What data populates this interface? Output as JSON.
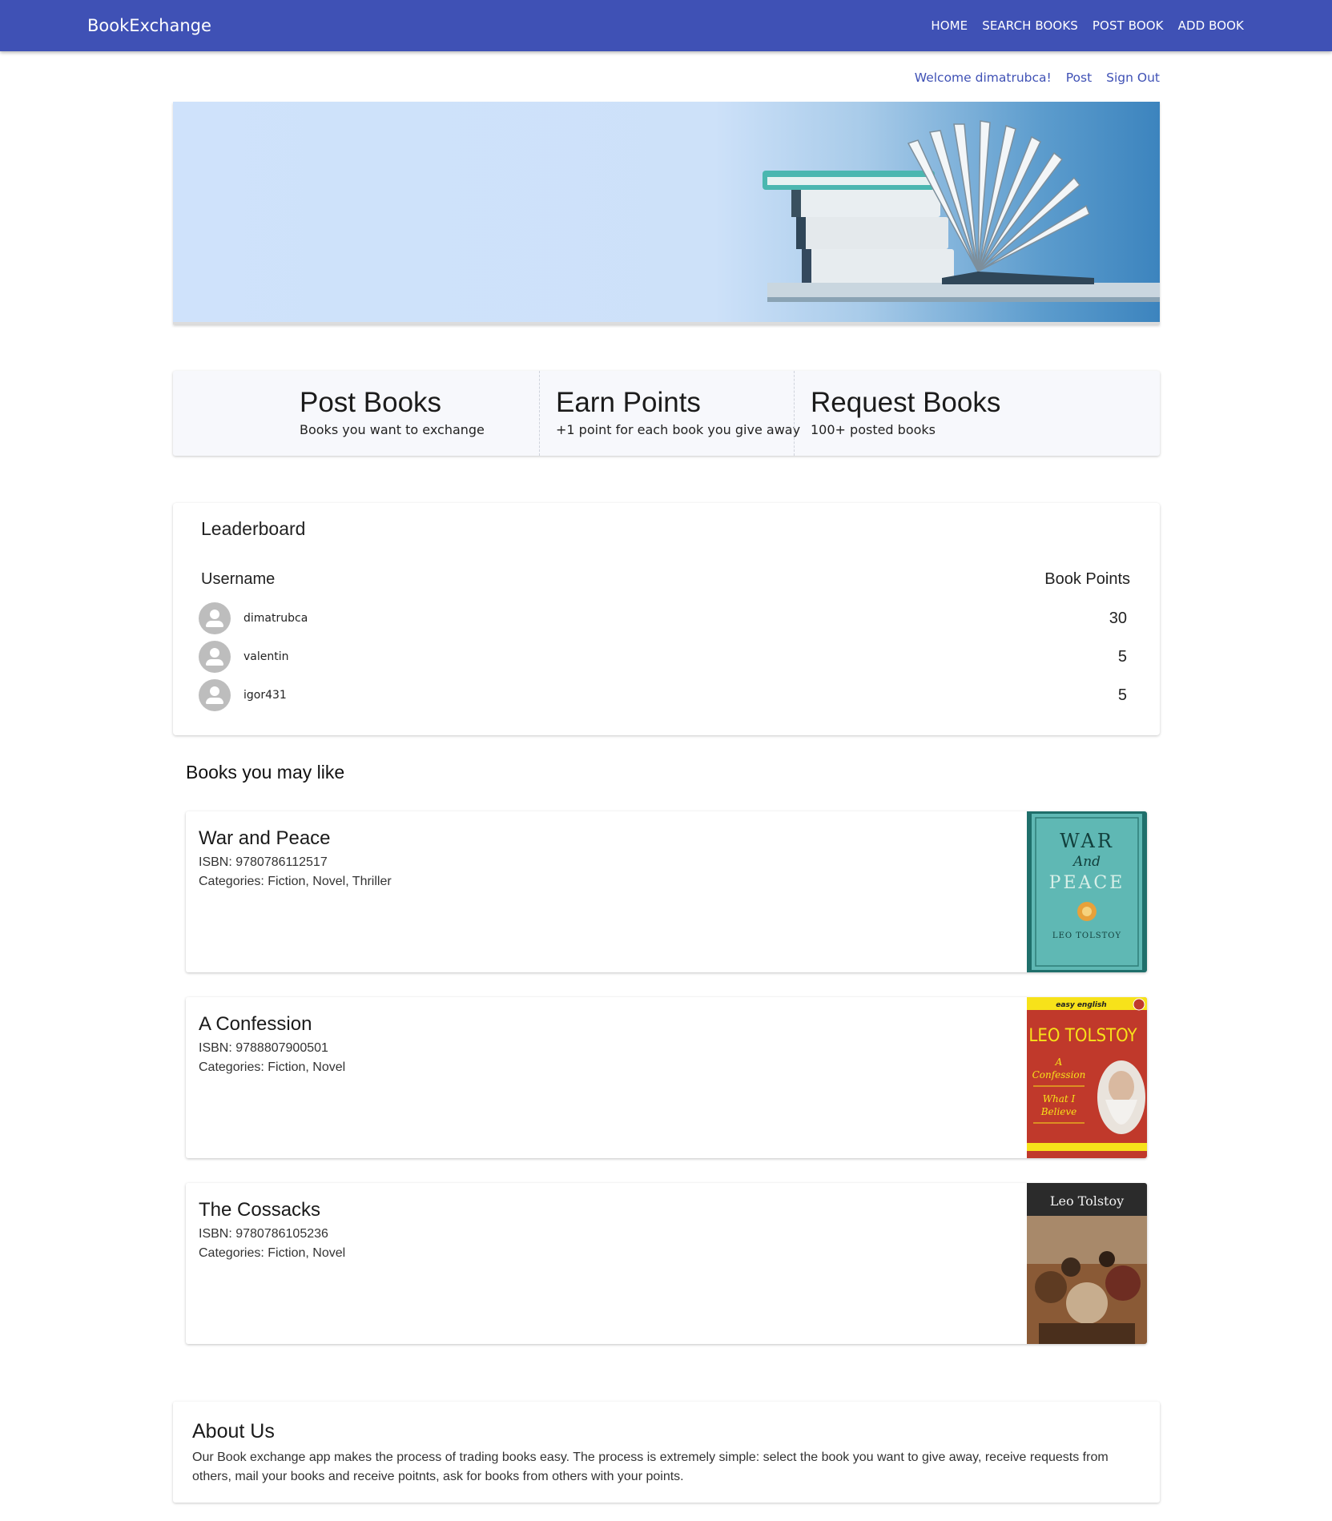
{
  "app": {
    "brand": "BookExchange"
  },
  "nav": {
    "home": "HOME",
    "search": "SEARCH BOOKS",
    "post": "POST BOOK",
    "add": "ADD BOOK"
  },
  "user_strip": {
    "welcome": "Welcome dimatrubca!",
    "post": "Post",
    "sign_out": "Sign Out"
  },
  "features": [
    {
      "title": "Post Books",
      "subtitle": "Books you want to exchange"
    },
    {
      "title": "Earn Points",
      "subtitle": "+1 point for each book you give away"
    },
    {
      "title": "Request Books",
      "subtitle": "100+ posted books"
    }
  ],
  "leaderboard": {
    "title": "Leaderboard",
    "col_user": "Username",
    "col_points": "Book Points",
    "rows": [
      {
        "username": "dimatrubca",
        "points": "30"
      },
      {
        "username": "valentin",
        "points": "5"
      },
      {
        "username": "igor431",
        "points": "5"
      }
    ]
  },
  "books_section": {
    "title": "Books you may like"
  },
  "books": [
    {
      "title": "War and Peace",
      "isbn": "ISBN: 9780786112517",
      "categories": "Categories: Fiction, Novel, Thriller",
      "cover": {
        "line1": "WAR",
        "line2": "And",
        "line3": "PEACE",
        "author": "LEO TOLSTOY",
        "color": "#5fb8b4"
      }
    },
    {
      "title": "A Confession",
      "isbn": "ISBN: 9788807900501",
      "categories": "Categories: Fiction, Novel",
      "cover": {
        "badge": "easy english",
        "author": "LEO TOLSTOY",
        "line1": "A",
        "line2": "Confession",
        "line3": "What I",
        "line4": "Believe",
        "color": "#c0392b"
      }
    },
    {
      "title": "The Cossacks",
      "isbn": "ISBN: 9780786105236",
      "categories": "Categories: Fiction, Novel",
      "cover": {
        "author": "Leo Tolstoy",
        "color": "#2b2b2b"
      }
    }
  ],
  "about": {
    "title": "About Us",
    "text": "Our Book exchange app makes the process of trading books easy. The process is extremely simple: select the book you want to give away, receive requests from others, mail your books and receive poitnts, ask for books from others with your points."
  }
}
